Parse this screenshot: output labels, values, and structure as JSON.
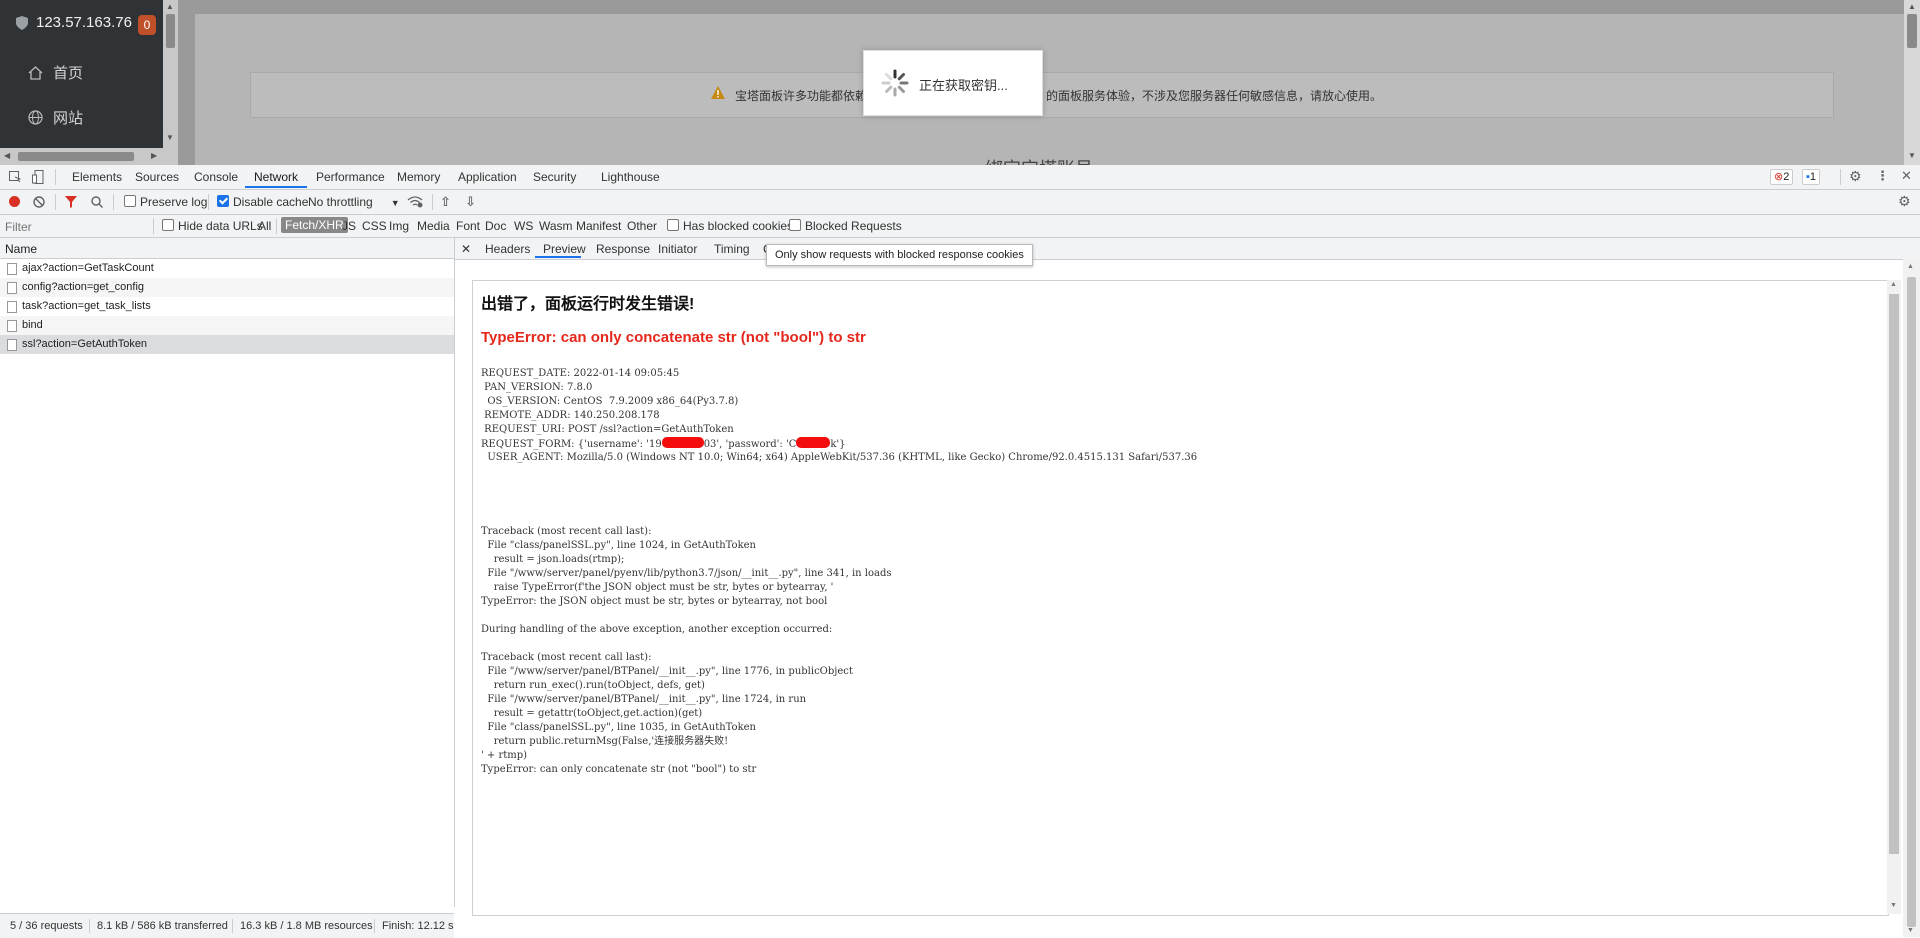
{
  "page": {
    "host": "123.57.163.76",
    "host_badge": "0",
    "nav": [
      {
        "label": "首页",
        "icon": "home-icon"
      },
      {
        "label": "网站",
        "icon": "globe-icon"
      }
    ],
    "notice_text": "宝塔面板许多功能都依赖",
    "notice_text_right": "的面板服务体验，不涉及您服务器任何敏感信息，请放心使用。",
    "bind_heading": "绑定宝塔账号",
    "modal_text": "正在获取密钥..."
  },
  "devtools": {
    "tabs": [
      "Elements",
      "Sources",
      "Console",
      "Network",
      "Performance",
      "Memory",
      "Application",
      "Security",
      "Lighthouse"
    ],
    "active_tab": "Network",
    "error_count": "2",
    "message_count": "1",
    "toolbar": {
      "preserve_log": "Preserve log",
      "disable_cache": "Disable cache",
      "throttling": "No throttling"
    },
    "filter": {
      "placeholder": "Filter",
      "hide_data_urls": "Hide data URLs",
      "types": [
        "All",
        "Fetch/XHR",
        "JS",
        "CSS",
        "Img",
        "Media",
        "Font",
        "Doc",
        "WS",
        "Wasm",
        "Manifest",
        "Other"
      ],
      "selected_type": "Fetch/XHR",
      "has_blocked_cookies": "Has blocked cookies",
      "blocked_requests": "Blocked Requests"
    },
    "name_header": "Name",
    "requests": [
      "ajax?action=GetTaskCount",
      "config?action=get_config",
      "task?action=get_task_lists",
      "bind",
      "ssl?action=GetAuthToken"
    ],
    "selected_request": "ssl?action=GetAuthToken",
    "status": {
      "requests": "5 / 36 requests",
      "transferred": "8.1 kB / 586 kB transferred",
      "resources": "16.3 kB / 1.8 MB resources",
      "finish": "Finish: 12.12 s"
    },
    "detail_tabs": [
      "Headers",
      "Preview",
      "Response",
      "Initiator",
      "Timing",
      "C"
    ],
    "active_detail_tab": "Preview",
    "tooltip": "Only show requests with blocked response cookies",
    "preview": {
      "title": "出错了，面板运行时发生错误!",
      "error": "TypeError: can only concatenate str (not \"bool\") to str",
      "env": {
        "request_date": "REQUEST_DATE: 2022-01-14 09:05:45",
        "pan_version": " PAN_VERSION: 7.8.0",
        "os_version": "  OS_VERSION: CentOS  7.9.2009 x86_64(Py3.7.8)",
        "remote_addr": " REMOTE_ADDR: 140.250.208.178",
        "request_uri": " REQUEST_URI: POST /ssl?action=GetAuthToken",
        "form_a": "REQUEST_FORM: {'username': '19",
        "form_b": "03', 'password': 'C",
        "form_c": "k'}",
        "user_agent": "  USER_AGENT: Mozilla/5.0 (Windows NT 10.0; Win64; x64) AppleWebKit/537.36 (KHTML, like Gecko) Chrome/92.0.4515.131 Safari/537.36"
      },
      "traceback1": "Traceback (most recent call last):\n  File \"class/panelSSL.py\", line 1024, in GetAuthToken\n    result = json.loads(rtmp);\n  File \"/www/server/panel/pyenv/lib/python3.7/json/__init__.py\", line 341, in loads\n    raise TypeError(f'the JSON object must be str, bytes or bytearray, '\nTypeError: the JSON object must be str, bytes or bytearray, not bool\n\nDuring handling of the above exception, another exception occurred:\n\nTraceback (most recent call last):\n  File \"/www/server/panel/BTPanel/__init__.py\", line 1776, in publicObject\n    return run_exec().run(toObject, defs, get)\n  File \"/www/server/panel/BTPanel/__init__.py\", line 1724, in run\n    result = getattr(toObject,get.action)(get)\n  File \"class/panelSSL.py\", line 1035, in GetAuthToken\n    return public.returnMsg(False,'连接服务器失败!\n' + rtmp)\nTypeError: can only concatenate str (not \"bool\") to str"
    }
  }
}
